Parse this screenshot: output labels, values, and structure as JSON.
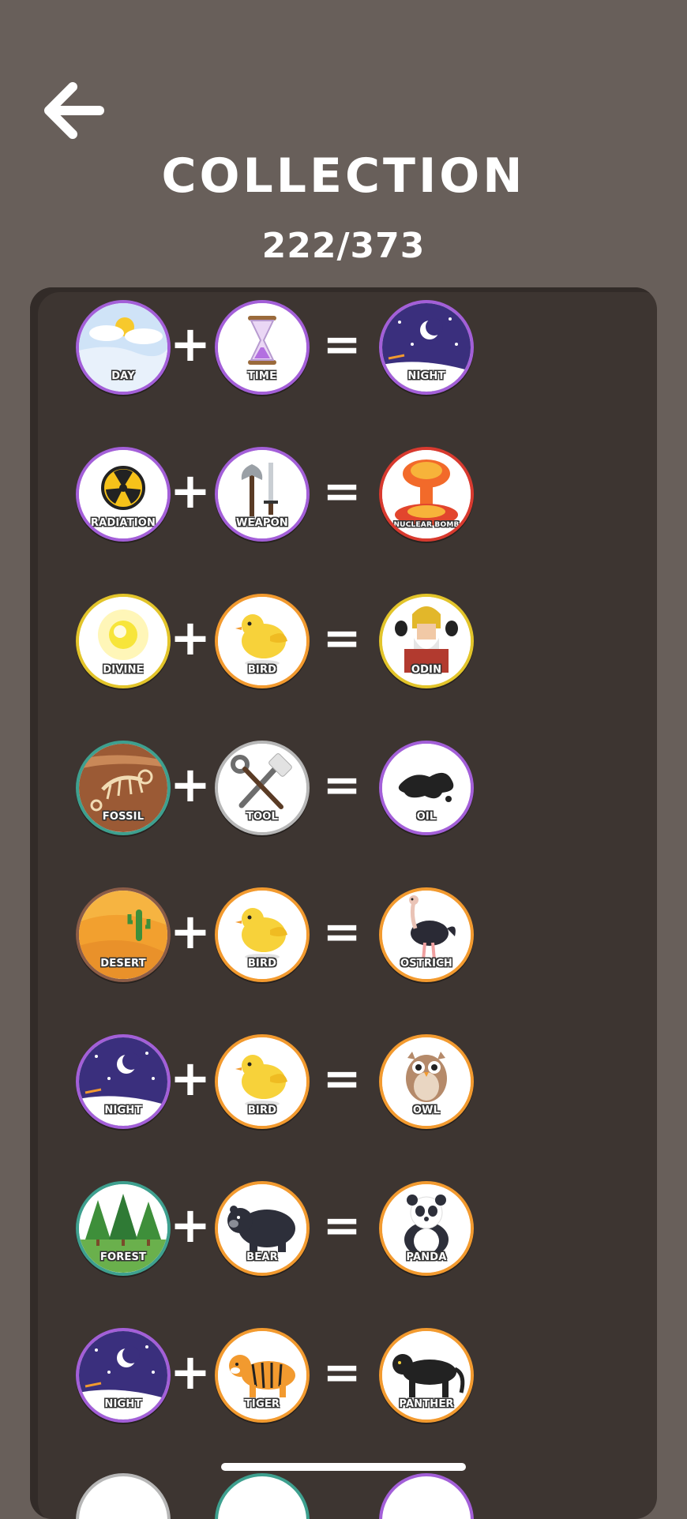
{
  "header": {
    "title": "COLLECTION",
    "counter": "222/373",
    "back_icon": "arrow-left-icon"
  },
  "operators": {
    "plus": "+",
    "equals": "="
  },
  "recipes": [
    {
      "a": {
        "label": "DAY",
        "icon": "clouds-sun-icon",
        "border": "#a35fd8"
      },
      "b": {
        "label": "TIME",
        "icon": "hourglass-icon",
        "border": "#a35fd8"
      },
      "result": {
        "label": "NIGHT",
        "icon": "moon-stars-icon",
        "border": "#a35fd8"
      }
    },
    {
      "a": {
        "label": "RADIATION",
        "icon": "radiation-icon",
        "border": "#a35fd8"
      },
      "b": {
        "label": "WEAPON",
        "icon": "axe-sword-icon",
        "border": "#a35fd8"
      },
      "result": {
        "label": "NUCLEAR BOMB",
        "icon": "mushroom-cloud-icon",
        "border": "#d83a2f"
      }
    },
    {
      "a": {
        "label": "DIVINE",
        "icon": "glowing-light-icon",
        "border": "#e2c42a"
      },
      "b": {
        "label": "BIRD",
        "icon": "bird-icon",
        "border": "#f29a2f"
      },
      "result": {
        "label": "ODIN",
        "icon": "odin-icon",
        "border": "#e2c42a"
      }
    },
    {
      "a": {
        "label": "FOSSIL",
        "icon": "fossil-icon",
        "border": "#3ea08f"
      },
      "b": {
        "label": "TOOL",
        "icon": "wrench-hammer-icon",
        "border": "#b7b7b7"
      },
      "result": {
        "label": "OIL",
        "icon": "oil-puddle-icon",
        "border": "#a35fd8"
      }
    },
    {
      "a": {
        "label": "DESERT",
        "icon": "desert-cactus-icon",
        "border": "#8b5c47"
      },
      "b": {
        "label": "BIRD",
        "icon": "bird-icon",
        "border": "#f29a2f"
      },
      "result": {
        "label": "OSTRICH",
        "icon": "ostrich-icon",
        "border": "#f29a2f"
      }
    },
    {
      "a": {
        "label": "NIGHT",
        "icon": "moon-stars-icon",
        "border": "#a35fd8"
      },
      "b": {
        "label": "BIRD",
        "icon": "bird-icon",
        "border": "#f29a2f"
      },
      "result": {
        "label": "OWL",
        "icon": "owl-icon",
        "border": "#f29a2f"
      }
    },
    {
      "a": {
        "label": "FOREST",
        "icon": "forest-icon",
        "border": "#3ea08f"
      },
      "b": {
        "label": "BEAR",
        "icon": "bear-icon",
        "border": "#f29a2f"
      },
      "result": {
        "label": "PANDA",
        "icon": "panda-icon",
        "border": "#f29a2f"
      }
    },
    {
      "a": {
        "label": "NIGHT",
        "icon": "moon-stars-icon",
        "border": "#a35fd8"
      },
      "b": {
        "label": "TIGER",
        "icon": "tiger-icon",
        "border": "#f29a2f"
      },
      "result": {
        "label": "PANTHER",
        "icon": "panther-icon",
        "border": "#f29a2f"
      }
    }
  ]
}
